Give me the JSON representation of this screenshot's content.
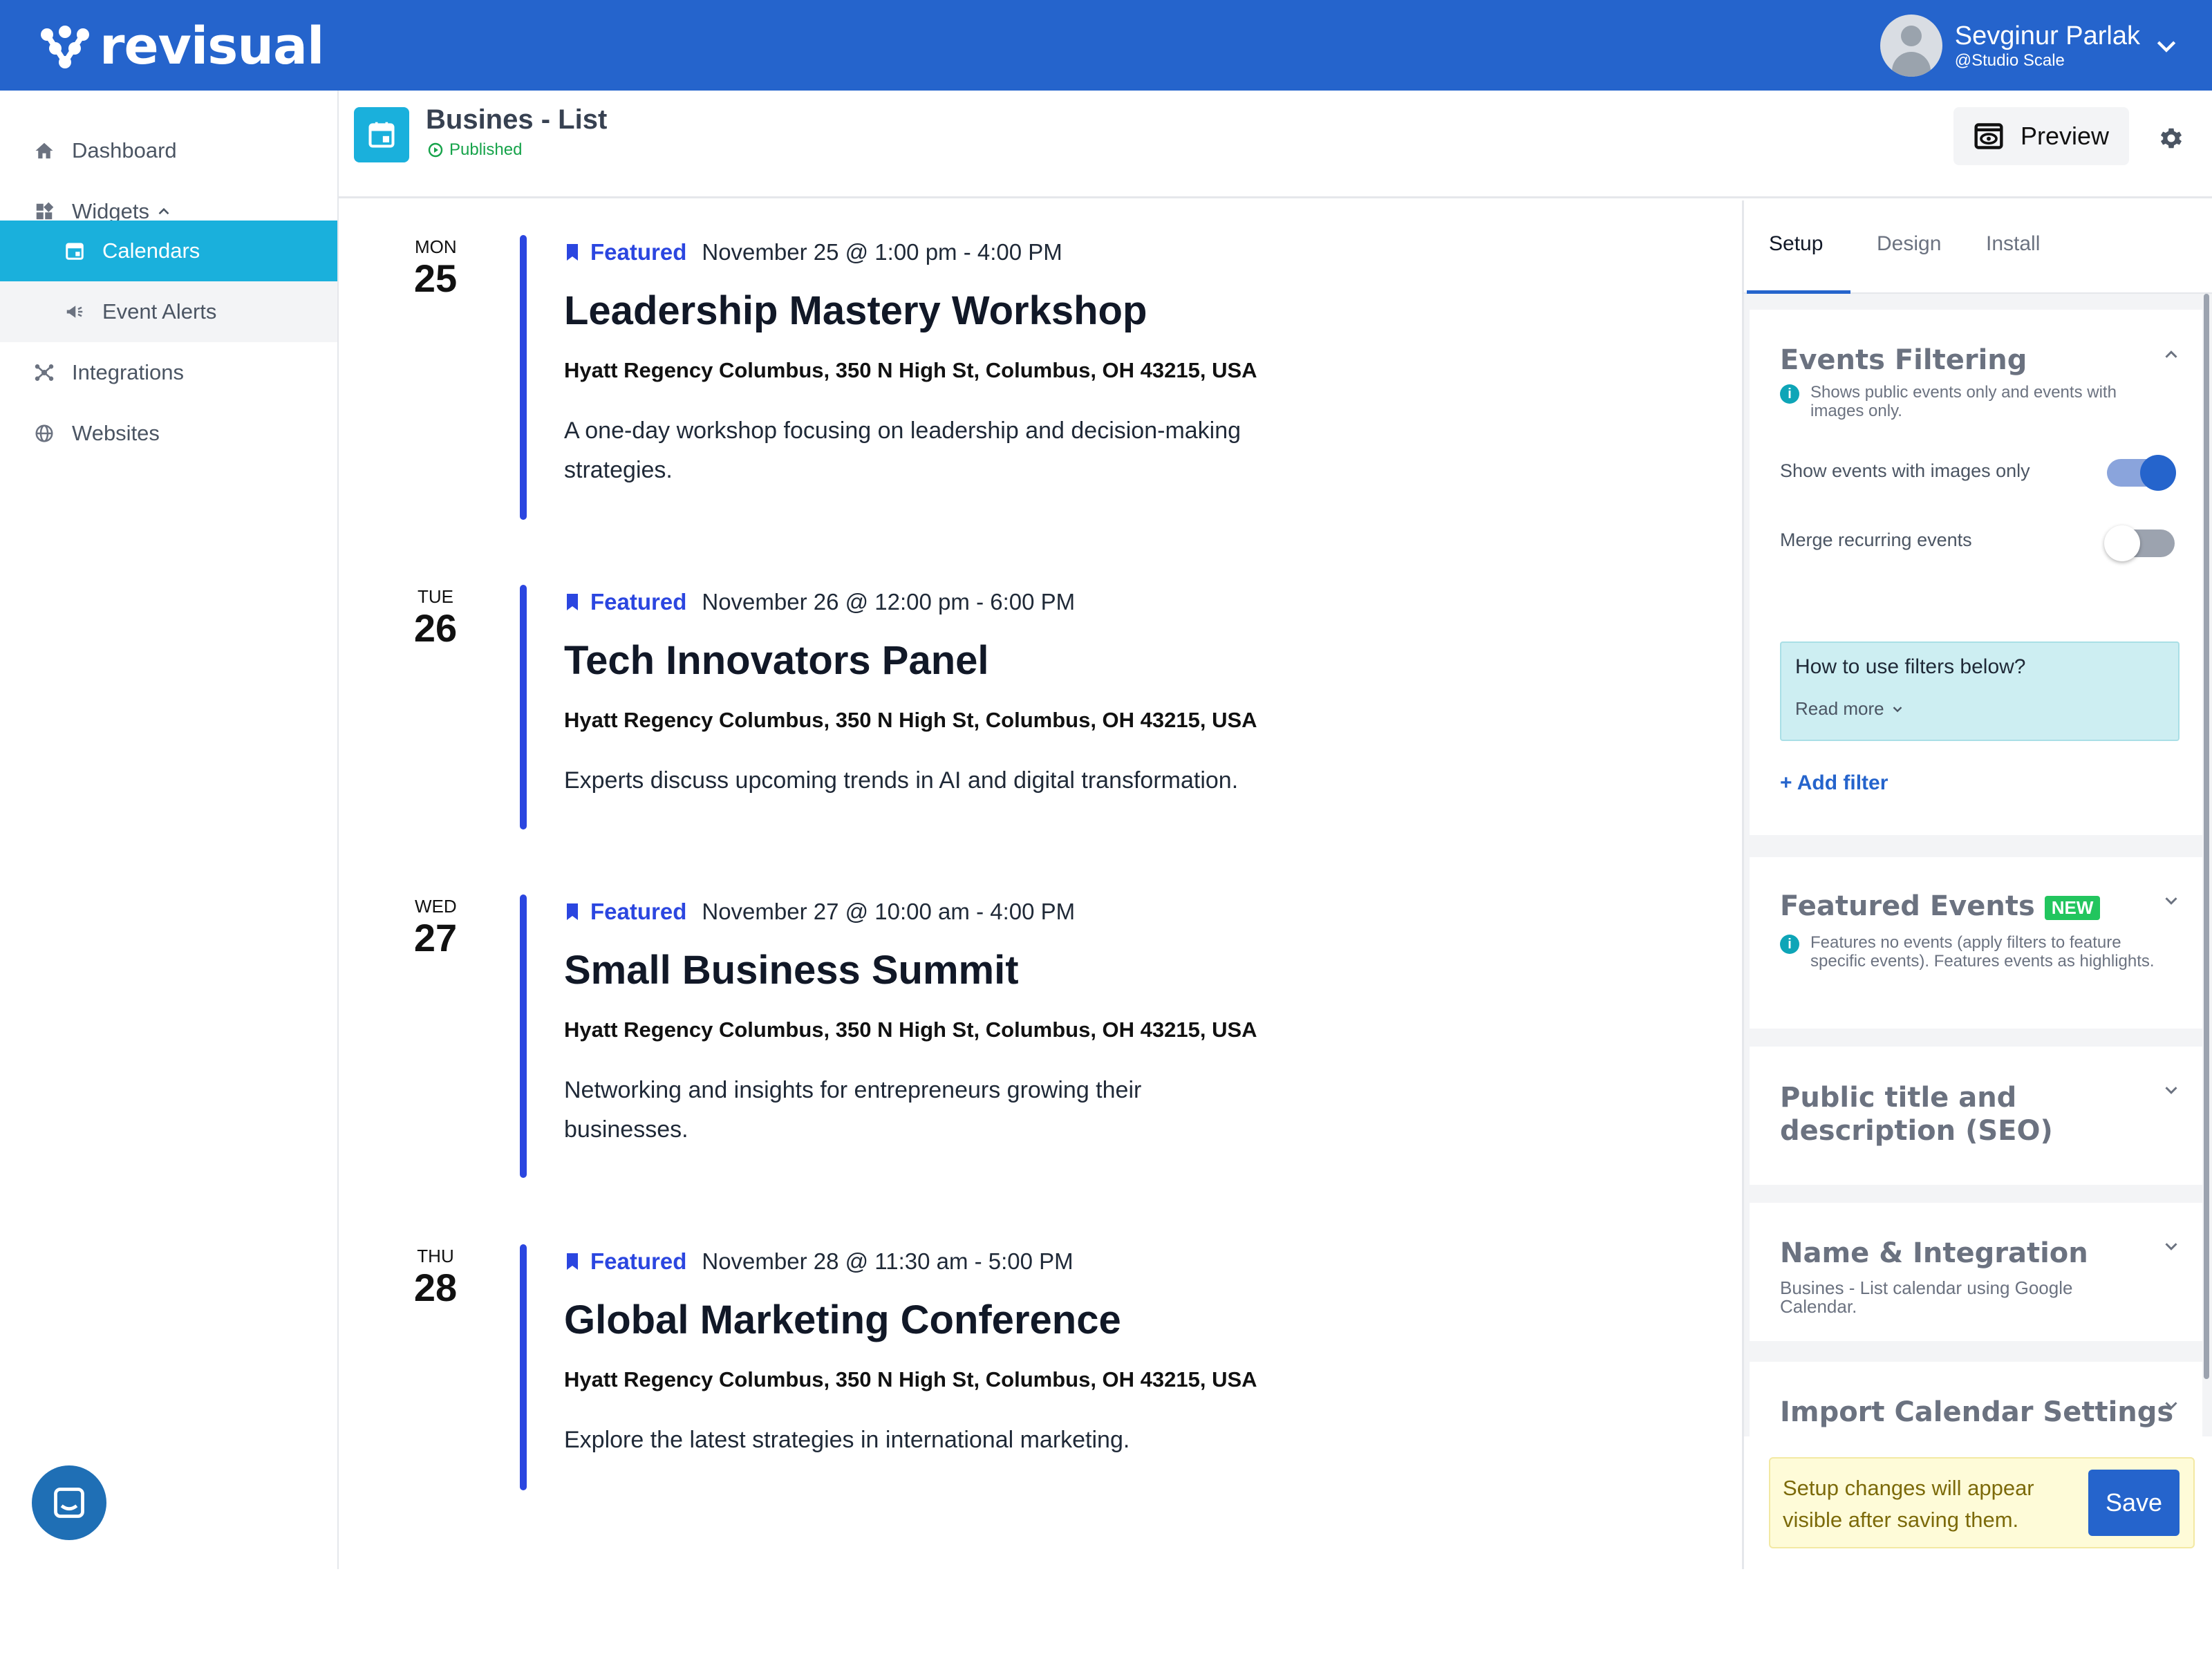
{
  "brand": {
    "name": "revisual",
    "color": "#2564cc",
    "accent": "#1ab0dc"
  },
  "user": {
    "name": "Sevginur Parlak",
    "handle": "@Studio Scale"
  },
  "sidebar": {
    "items": [
      {
        "label": "Dashboard",
        "icon": "home-icon"
      },
      {
        "label": "Widgets",
        "icon": "widgets-icon"
      },
      {
        "label": "Calendars",
        "icon": "calendar-icon"
      },
      {
        "label": "Event Alerts",
        "icon": "megaphone-icon"
      },
      {
        "label": "Integrations",
        "icon": "integrations-icon"
      },
      {
        "label": "Websites",
        "icon": "globe-icon"
      }
    ]
  },
  "header": {
    "title": "Busines - List",
    "status": "Published",
    "preview_label": "Preview"
  },
  "events": [
    {
      "weekday": "MON",
      "day": "25",
      "featured": "Featured",
      "datetime": "November 25 @ 1:00 pm - 4:00 PM",
      "title": "Leadership Mastery Workshop",
      "location": "Hyatt Regency Columbus, 350 N High St, Columbus, OH 43215, USA",
      "description": "A one-day workshop focusing on leadership and decision-making strategies."
    },
    {
      "weekday": "TUE",
      "day": "26",
      "featured": "Featured",
      "datetime": "November 26 @ 12:00 pm - 6:00 PM",
      "title": "Tech Innovators Panel",
      "location": "Hyatt Regency Columbus, 350 N High St, Columbus, OH 43215, USA",
      "description": "Experts discuss upcoming trends in AI and digital transformation."
    },
    {
      "weekday": "WED",
      "day": "27",
      "featured": "Featured",
      "datetime": "November 27 @ 10:00 am - 4:00 PM",
      "title": "Small Business Summit",
      "location": "Hyatt Regency Columbus, 350 N High St, Columbus, OH 43215, USA",
      "description": "Networking and insights for entrepreneurs growing their businesses."
    },
    {
      "weekday": "THU",
      "day": "28",
      "featured": "Featured",
      "datetime": "November 28 @ 11:30 am - 5:00 PM",
      "title": "Global Marketing Conference",
      "location": "Hyatt Regency Columbus, 350 N High St, Columbus, OH 43215, USA",
      "description": "Explore the latest strategies in international marketing."
    }
  ],
  "panel": {
    "tabs": [
      "Setup",
      "Design",
      "Install"
    ],
    "filtering": {
      "title": "Events Filtering",
      "info": "Shows public events only and events with images only.",
      "toggle1_label": "Show events with images only",
      "toggle1_on": true,
      "toggle2_label": "Merge recurring events",
      "toggle2_on": false,
      "help_title": "How to use filters below?",
      "help_more": "Read more",
      "add_filter": "+ Add filter"
    },
    "featured": {
      "title": "Featured Events",
      "badge": "NEW",
      "info": "Features no events (apply filters to feature specific events). Features events as highlights."
    },
    "seo": {
      "title": "Public title and description (SEO)"
    },
    "integration": {
      "title": "Name & Integration",
      "subtitle": "Busines - List calendar using Google Calendar."
    },
    "import": {
      "title": "Import Calendar Settings"
    },
    "save_note": "Setup changes will appear visible after saving them.",
    "save_label": "Save"
  }
}
